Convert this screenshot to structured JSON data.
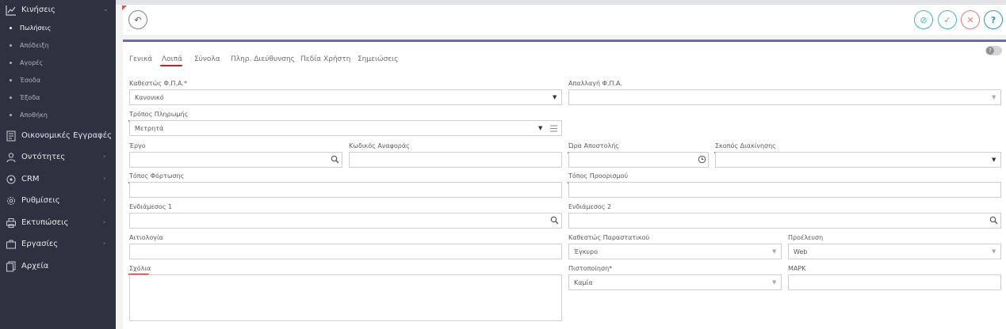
{
  "sidebar": {
    "main_item": {
      "label": "Κινήσεις",
      "icon": "chart-icon"
    },
    "sub_items": [
      {
        "label": "Πωλήσεις",
        "active": true
      },
      {
        "label": "Απόδειξη"
      },
      {
        "label": "Αγορές"
      },
      {
        "label": "Έσοδα"
      },
      {
        "label": "Έξοδα"
      },
      {
        "label": "Αποθήκη"
      }
    ],
    "items": [
      {
        "label": "Οικονομικές Εγγραφές",
        "icon": "ledger-icon"
      },
      {
        "label": "Οντότητες",
        "icon": "users-icon"
      },
      {
        "label": "CRM",
        "icon": "crm-icon"
      },
      {
        "label": "Ρυθμίσεις",
        "icon": "settings-icon"
      },
      {
        "label": "Εκτυπώσεις",
        "icon": "print-icon"
      },
      {
        "label": "Εργασίες",
        "icon": "briefcase-icon"
      },
      {
        "label": "Αρχεία",
        "icon": "files-icon"
      }
    ]
  },
  "tabs": [
    {
      "label": "Γενικά"
    },
    {
      "label": "Λοιπά",
      "active": true
    },
    {
      "label": "Σύνολα"
    },
    {
      "label": "Πληρ. Διεύθυνσης"
    },
    {
      "label": "Πεδία Χρήστη"
    },
    {
      "label": "Σημειώσεις"
    }
  ],
  "form": {
    "vat_status": {
      "label": "Καθεστώς Φ.Π.Α.*",
      "value": "Κανονικό"
    },
    "vat_exemption": {
      "label": "Απαλλαγή Φ.Π.Α.",
      "value": ""
    },
    "payment_method": {
      "label": "Τρόπος Πληρωμής",
      "value": "Μετρητά"
    },
    "project": {
      "label": "Έργο",
      "value": ""
    },
    "reference_code": {
      "label": "Κωδικός Αναφοράς",
      "value": ""
    },
    "dispatch_time": {
      "label": "Ώρα Αποστολής",
      "value": ""
    },
    "movement_purpose": {
      "label": "Σκοπός Διακίνησης",
      "value": ""
    },
    "loading_place": {
      "label": "Τόπος Φόρτωσης",
      "value": ""
    },
    "destination_place": {
      "label": "Τόπος Προορισμού",
      "value": ""
    },
    "intermediary1": {
      "label": "Ενδιάμεσος 1",
      "value": ""
    },
    "intermediary2": {
      "label": "Ενδιάμεσος 2",
      "value": ""
    },
    "justification": {
      "label": "Αιτιολογία",
      "value": ""
    },
    "document_status": {
      "label": "Καθεστώς Παραστατικού",
      "value": "Έγκυρο"
    },
    "origin": {
      "label": "Προέλευση",
      "value": "Web"
    },
    "comments": {
      "label": "Σχόλια",
      "value": ""
    },
    "certification": {
      "label": "Πιστοποίηση*",
      "value": "Καμία"
    },
    "mark": {
      "label": "ΜΑΡΚ",
      "value": ""
    }
  },
  "colors": {
    "sidebar_bg": "#2e3240",
    "annotation": "#cc1f1f",
    "accent_teal": "#3fb8b0",
    "accent_red": "#e07a7a",
    "accent_blue": "#2c8fd6"
  }
}
